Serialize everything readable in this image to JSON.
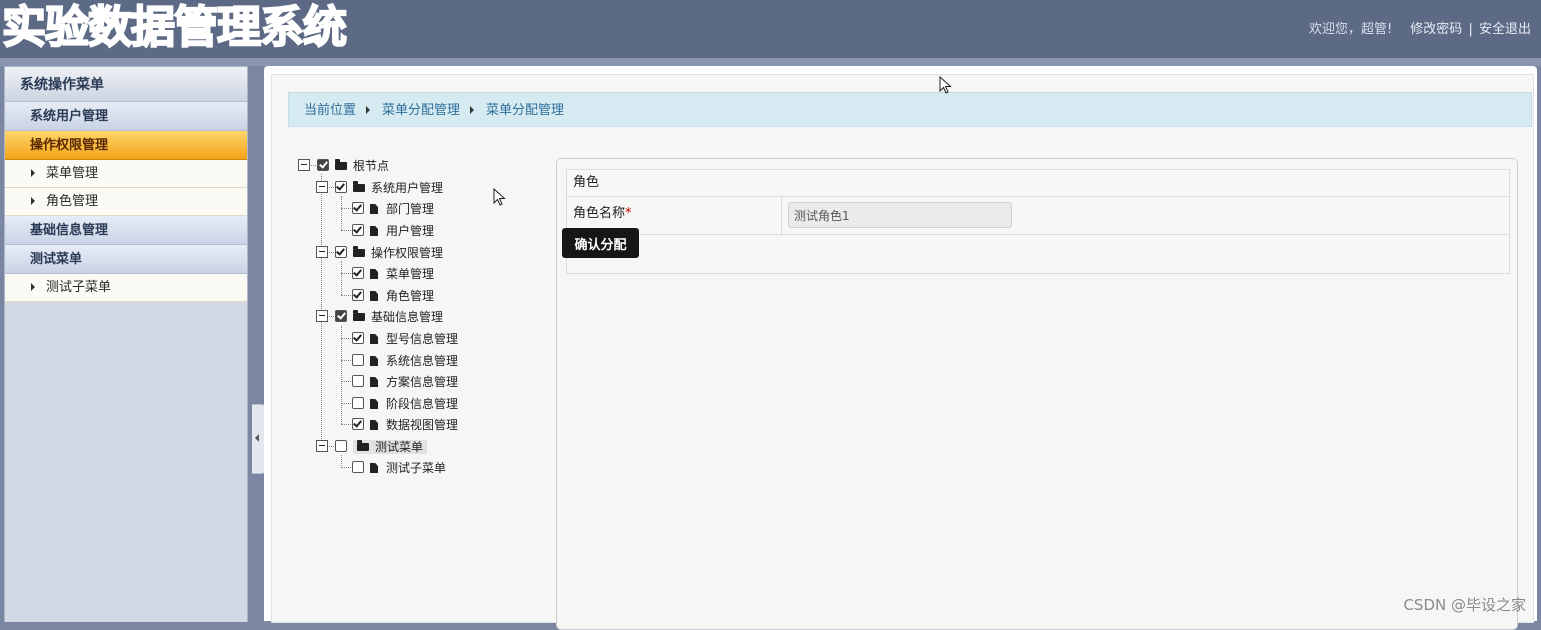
{
  "header": {
    "app_title": "实验数据管理系统",
    "welcome": "欢迎您，超管!",
    "change_password": "修改密码",
    "separator": "|",
    "logout": "安全退出"
  },
  "sidebar": {
    "title": "系统操作菜单",
    "groups": [
      {
        "label": "系统用户管理"
      },
      {
        "label": "操作权限管理",
        "subs": [
          "菜单管理",
          "角色管理"
        ]
      },
      {
        "label": "基础信息管理"
      },
      {
        "label": "测试菜单",
        "subs": [
          "测试子菜单"
        ]
      }
    ]
  },
  "breadcrumb": [
    "当前位置",
    "菜单分配管理",
    "菜单分配管理"
  ],
  "tree": {
    "root": "根节点",
    "nodes": [
      {
        "label": "系统用户管理",
        "children": [
          "部门管理",
          "用户管理"
        ]
      },
      {
        "label": "操作权限管理",
        "children": [
          "菜单管理",
          "角色管理"
        ]
      },
      {
        "label": "基础信息管理",
        "children": [
          "型号信息管理",
          "系统信息管理",
          "方案信息管理",
          "阶段信息管理",
          "数据视图管理"
        ]
      },
      {
        "label": "测试菜单",
        "children": [
          "测试子菜单"
        ]
      }
    ]
  },
  "form": {
    "section_title": "角色",
    "role_name_label": "角色名称",
    "required_mark": "*",
    "role_name_value": "测试角色1",
    "confirm_button": "确认分配"
  },
  "watermark": "CSDN @毕设之家",
  "colors": {
    "header_bg": "#5d6a86",
    "active_menu": "#f3a319",
    "breadcrumb_bg": "#d6eaf2",
    "button_bg": "#161616"
  }
}
